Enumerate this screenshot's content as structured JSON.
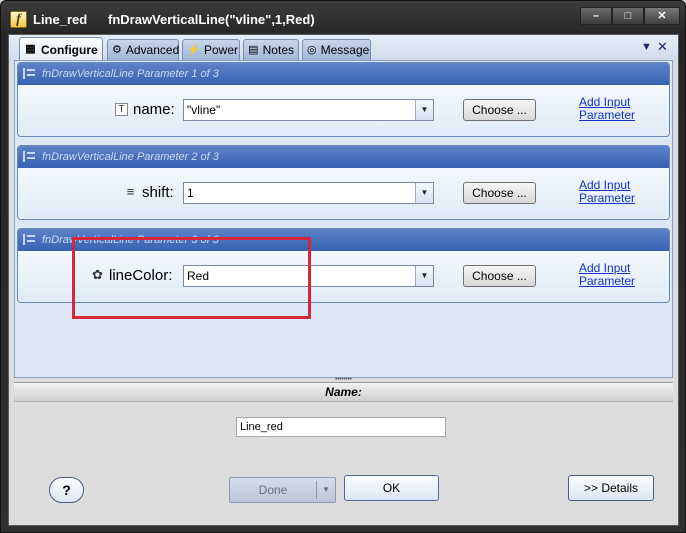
{
  "window": {
    "name": "Line_red",
    "function": "fnDrawVerticalLine(\"vline\",1,Red)",
    "app_icon": "f",
    "minimize": "–",
    "maximize": "□",
    "close": "✕"
  },
  "tabs": [
    {
      "label": "Configure",
      "icon": "configure-icon"
    },
    {
      "label": "Advanced",
      "icon": "advanced-icon"
    },
    {
      "label": "Power",
      "icon": "power-icon"
    },
    {
      "label": "Notes",
      "icon": "notes-icon"
    },
    {
      "label": "Message",
      "icon": "message-icon"
    }
  ],
  "params": [
    {
      "header": "fnDrawVerticalLine Parameter 1 of 3",
      "name": "name:",
      "value": "\"vline\"",
      "choose": "Choose ...",
      "link_line1": "Add Input",
      "link_line2": "Parameter"
    },
    {
      "header": "fnDrawVerticalLine Parameter 2 of 3",
      "name": "shift:",
      "value": "1",
      "choose": "Choose ...",
      "link_line1": "Add Input",
      "link_line2": "Parameter"
    },
    {
      "header": "fnDrawVerticalLine Parameter 3 of 3",
      "name": "lineColor:",
      "value": "Red",
      "choose": "Choose ...",
      "link_line1": "Add Input",
      "link_line2": "Parameter"
    }
  ],
  "bottom": {
    "name_label": "Name:",
    "name_value": "Line_red",
    "help": "?",
    "done": "Done",
    "ok": "OK",
    "details": ">> Details"
  },
  "colors": {
    "highlight": "#d6273b",
    "group_header": "#3762b2",
    "link": "#1432c8"
  }
}
